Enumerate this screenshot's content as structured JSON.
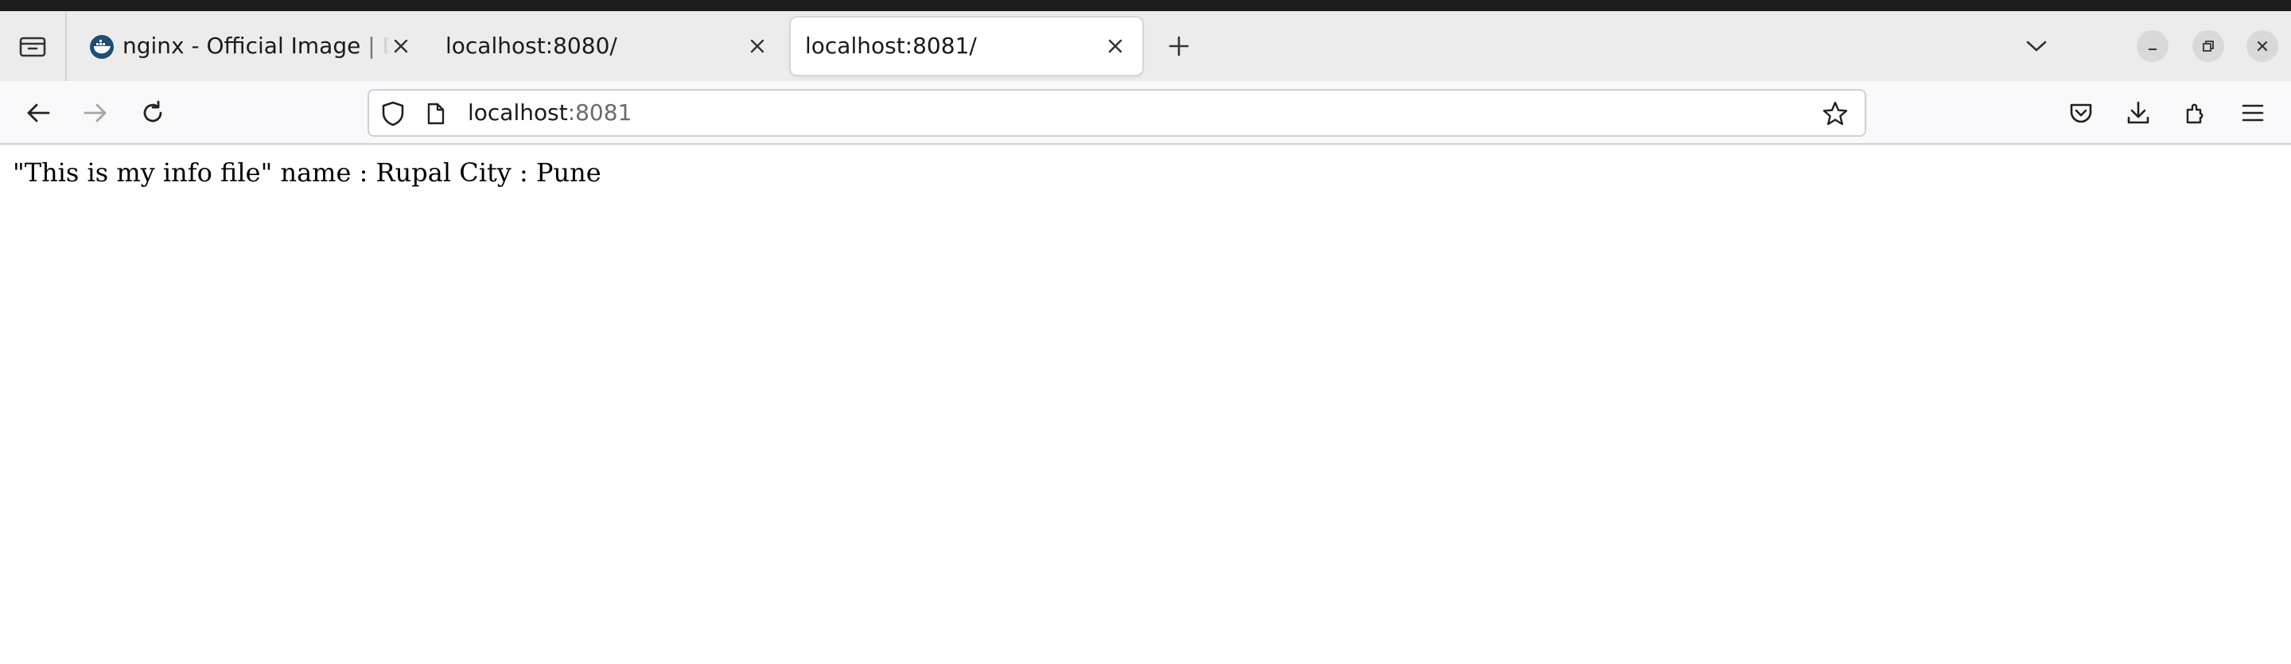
{
  "browser": {
    "tabs": [
      {
        "title": "nginx - Official Image | Docker Hub",
        "favicon": "docker-whale-icon",
        "active": false
      },
      {
        "title": "localhost:8080/",
        "active": false
      },
      {
        "title": "localhost:8081/",
        "active": true
      }
    ],
    "url": {
      "host": "localhost",
      "port": ":8081"
    },
    "icons": {
      "tab_list": "tab-list-icon",
      "new_tab": "plus-icon",
      "list_all_tabs": "chevron-down-icon",
      "minimize": "minimize-icon",
      "restore": "restore-icon",
      "close_window": "close-icon",
      "back": "back-arrow-icon",
      "forward": "forward-arrow-icon",
      "reload": "reload-icon",
      "tracking_protection": "shield-icon",
      "page_info": "page-icon",
      "bookmark": "star-icon",
      "pocket": "pocket-icon",
      "downloads": "download-icon",
      "extensions": "puzzle-icon",
      "menu": "hamburger-menu-icon"
    },
    "colors": {
      "tabstrip": "#ececec",
      "toolbar": "#f9f9fb",
      "titlebar": "#1c1c1c"
    }
  },
  "page": {
    "text": "\"This is my info file\" name : Rupal City : Pune"
  }
}
